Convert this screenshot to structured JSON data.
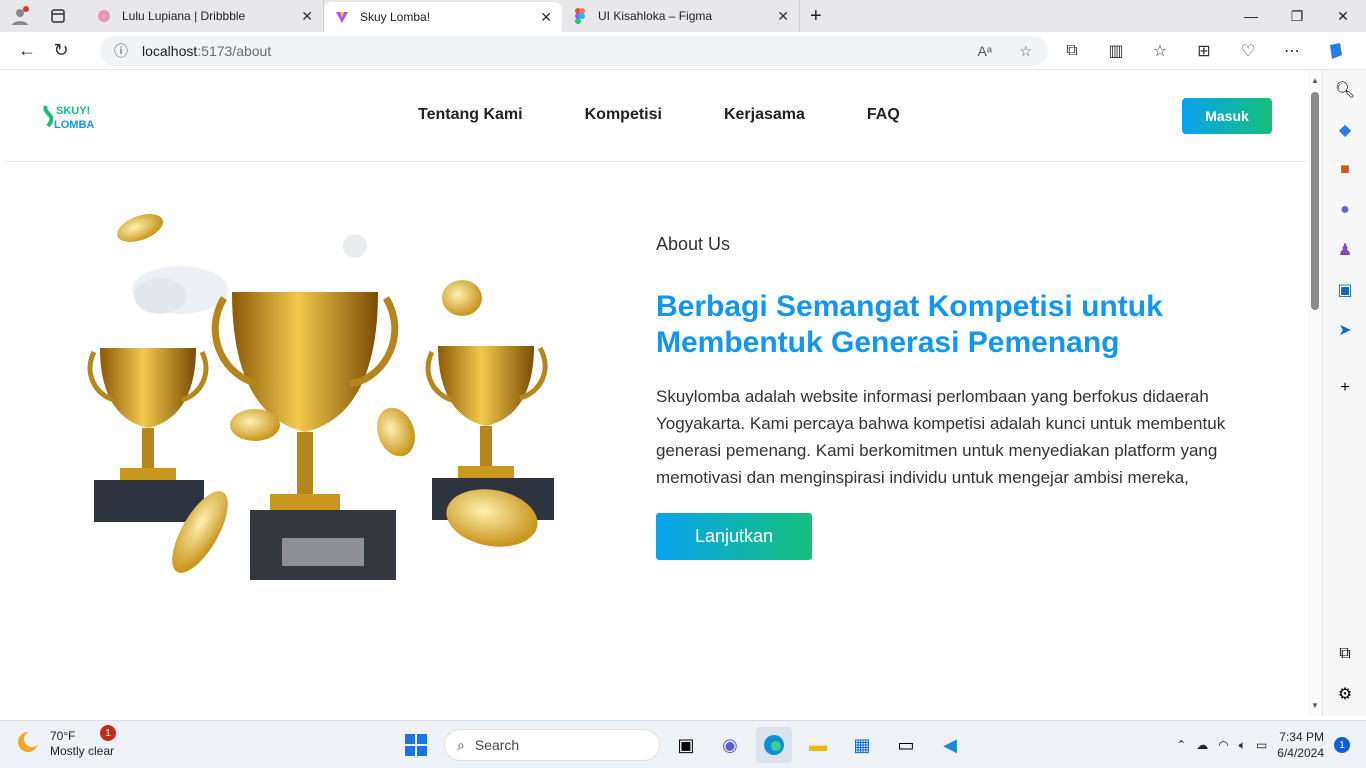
{
  "browser": {
    "tabs": [
      {
        "title": "Lulu Lupiana | Dribbble"
      },
      {
        "title": "Skuy Lomba!"
      },
      {
        "title": "UI Kisahloka – Figma"
      }
    ],
    "url_host": "localhost",
    "url_path": ":5173/about"
  },
  "site": {
    "logo_top": "SKUY!",
    "logo_bottom": "LOMBA",
    "menu": [
      {
        "label": "Tentang Kami"
      },
      {
        "label": "Kompetisi"
      },
      {
        "label": "Kerjasama"
      },
      {
        "label": "FAQ"
      }
    ],
    "login_label": "Masuk"
  },
  "hero": {
    "eyebrow": "About Us",
    "headline_line1": "Berbagi Semangat Kompetisi untuk",
    "headline_line2": "Membentuk Generasi Pemenang",
    "paragraph": "Skuylomba adalah website informasi perlombaan yang berfokus didaerah Yogyakarta. Kami percaya bahwa kompetisi adalah kunci untuk membentuk generasi pemenang. Kami berkomitmen untuk menyediakan platform yang memotivasi dan menginspirasi individu untuk mengejar ambisi mereka,",
    "cta_label": "Lanjutkan"
  },
  "taskbar": {
    "temp": "70°F",
    "weather": "Mostly clear",
    "weather_badge": "1",
    "search_placeholder": "Search",
    "time": "7:34 PM",
    "date": "6/4/2024",
    "notif_count": "1"
  },
  "colors": {
    "brand_blue": "#1296ef",
    "brand_green": "#14c079"
  }
}
